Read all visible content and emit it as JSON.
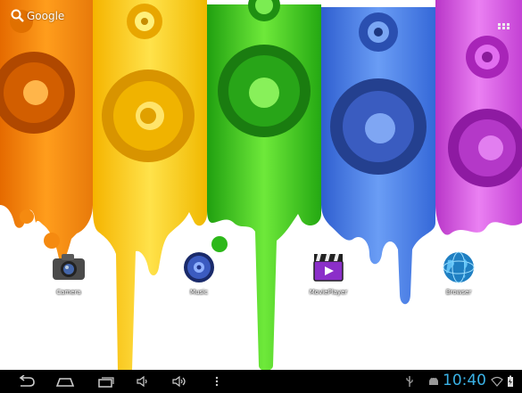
{
  "search": {
    "label": "Google"
  },
  "shortcuts": [
    {
      "label": "Camera",
      "icon": "camera-icon"
    },
    {
      "label": "Music",
      "icon": "music-speaker-icon"
    },
    {
      "label": "MoviePlayer",
      "icon": "clapperboard-icon"
    },
    {
      "label": "Browser",
      "icon": "globe-icon"
    }
  ],
  "status": {
    "time": "10:40"
  },
  "colors": {
    "orange": "#f7921e",
    "yellow": "#ffd200",
    "green": "#3cc01e",
    "blue": "#3f7ae6",
    "magenta": "#d552e0",
    "clock": "#3ab2e6"
  }
}
